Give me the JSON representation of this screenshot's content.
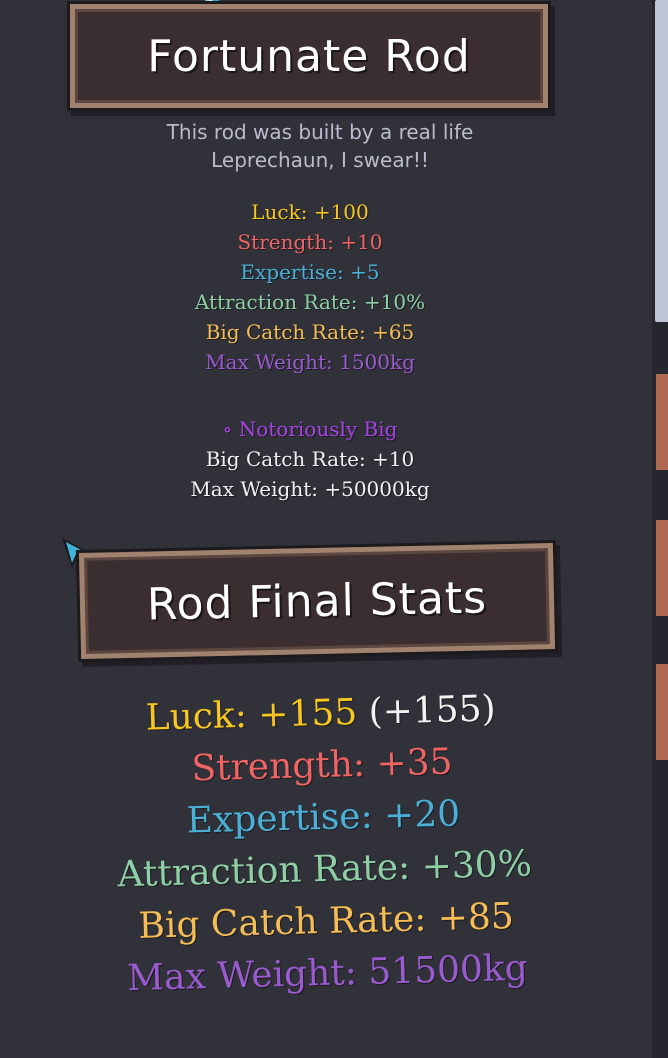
{
  "rod_card": {
    "title": "Fortunate Rod",
    "description_line1": "This rod was built by a real life",
    "description_line2": "Leprechaun, I swear!!",
    "stats": [
      {
        "label": "Luck:",
        "value": "+100",
        "color": "#f7c61f"
      },
      {
        "label": "Strength:",
        "value": "+10",
        "color": "#f06464"
      },
      {
        "label": "Expertise:",
        "value": "+5",
        "color": "#4bb0d8"
      },
      {
        "label": "Attraction Rate:",
        "value": "+10%",
        "color": "#8ecfa5"
      },
      {
        "label": "Big Catch Rate:",
        "value": "+65",
        "color": "#f6bd55"
      },
      {
        "label": "Max Weight:",
        "value": "1500kg",
        "color": "#9b5ad0"
      }
    ]
  },
  "modifier": {
    "bullet": "∘",
    "name": "Notoriously Big",
    "lines": [
      {
        "label": "Big Catch Rate:",
        "value": "+10"
      },
      {
        "label": "Max Weight:",
        "value": "+50000kg"
      }
    ]
  },
  "final_stats": {
    "title": "Rod Final Stats",
    "luck": {
      "label": "Luck:",
      "value": "+155",
      "extra": "(+155)"
    },
    "strength": {
      "label": "Strength:",
      "value": "+35"
    },
    "expertise": {
      "label": "Expertise:",
      "value": "+20"
    },
    "attraction": {
      "label": "Attraction Rate:",
      "value": "+30%"
    },
    "big_catch": {
      "label": "Big Catch Rate:",
      "value": "+85"
    },
    "max_weight": {
      "label": "Max Weight:",
      "value": "51500kg"
    }
  },
  "colors": {
    "panel_bg": "#303139",
    "banner_bg": "#3a2e31",
    "banner_border": "#a0826e",
    "description": "#b9bccd"
  }
}
